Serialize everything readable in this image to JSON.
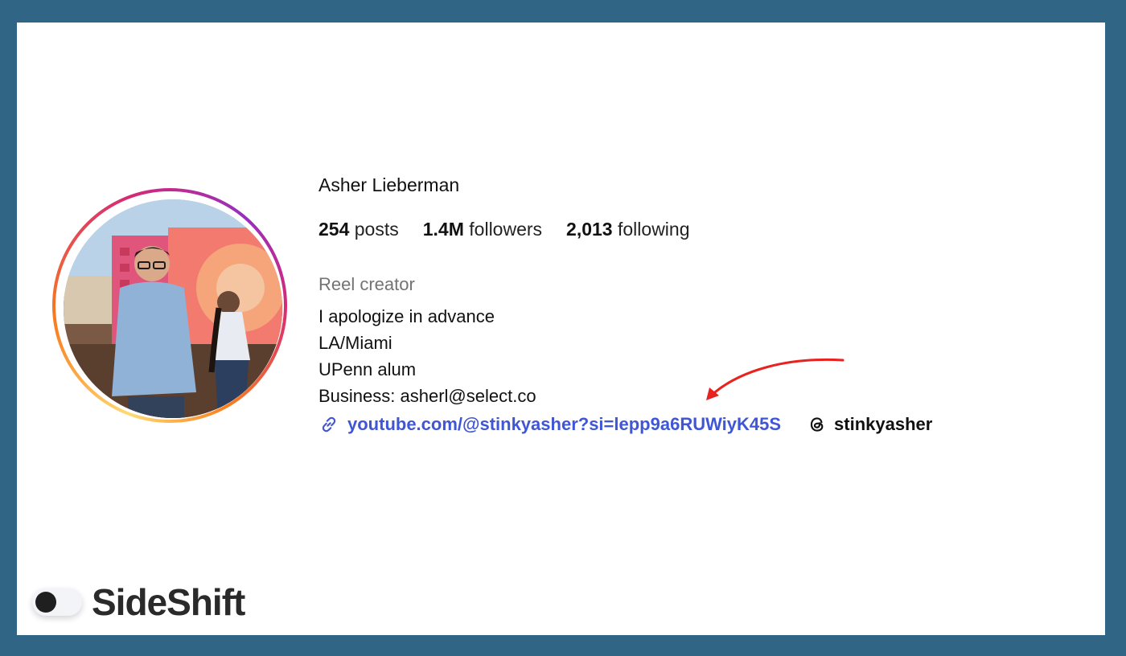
{
  "profile": {
    "name": "Asher Lieberman",
    "stats": {
      "posts_count": "254",
      "posts_label": "posts",
      "followers_count": "1.4M",
      "followers_label": "followers",
      "following_count": "2,013",
      "following_label": "following"
    },
    "category": "Reel creator",
    "bio": [
      "I apologize in advance",
      "LA/Miami",
      "UPenn alum",
      "Business: asherl@select.co"
    ],
    "link": {
      "icon": "link-icon",
      "text": "youtube.com/@stinkyasher?si=lepp9a6RUWiyK45S"
    },
    "threads": {
      "icon": "threads-icon",
      "handle": "stinkyasher"
    }
  },
  "branding": {
    "name": "SideShift",
    "icon": "toggle-icon"
  },
  "colors": {
    "frame": "#306585",
    "link": "#3f57d6",
    "arrow": "#e8231f",
    "category": "#737373"
  }
}
